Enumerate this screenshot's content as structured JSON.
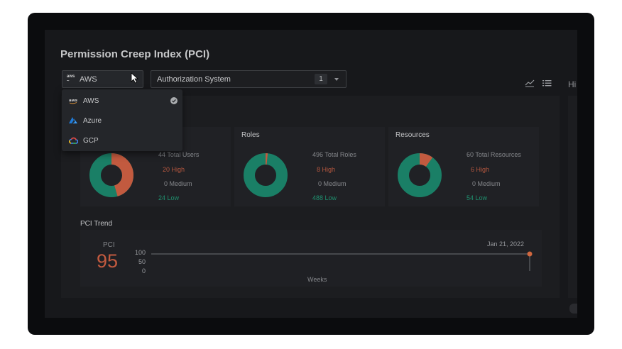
{
  "page": {
    "title": "Permission Creep Index (PCI)"
  },
  "filters": {
    "cloud_selected": "AWS",
    "auth_system_label": "Authorization System",
    "auth_system_count": "1"
  },
  "dropdown": {
    "items": [
      {
        "label": "AWS",
        "icon": "aws-logo-icon",
        "selected": true
      },
      {
        "label": "Azure",
        "icon": "azure-logo-icon",
        "selected": false
      },
      {
        "label": "GCP",
        "icon": "gcp-logo-icon",
        "selected": false
      }
    ]
  },
  "toolbar": {
    "partial_label": "Hi"
  },
  "cards": [
    {
      "title": "",
      "total": "44 Total Users",
      "high": "20 High",
      "medium": "0 Medium",
      "low": "24 Low",
      "high_fraction": 0.4545
    },
    {
      "title": "Roles",
      "total": "496 Total Roles",
      "high": "8 High",
      "medium": "0 Medium",
      "low": "488 Low",
      "high_fraction": 0.0161
    },
    {
      "title": "Resources",
      "total": "60 Total Resources",
      "high": "6 High",
      "medium": "0 Medium",
      "low": "54 Low",
      "high_fraction": 0.1
    }
  ],
  "trend": {
    "title": "PCI Trend",
    "pci_label": "PCI",
    "pci_value": "95",
    "y_ticks": [
      "100",
      "50",
      "0"
    ],
    "date": "Jan 21, 2022",
    "x_label": "Weeks"
  },
  "colors": {
    "high": "#c25a3f",
    "low": "#1a7f66",
    "accent": "#d0673f"
  }
}
